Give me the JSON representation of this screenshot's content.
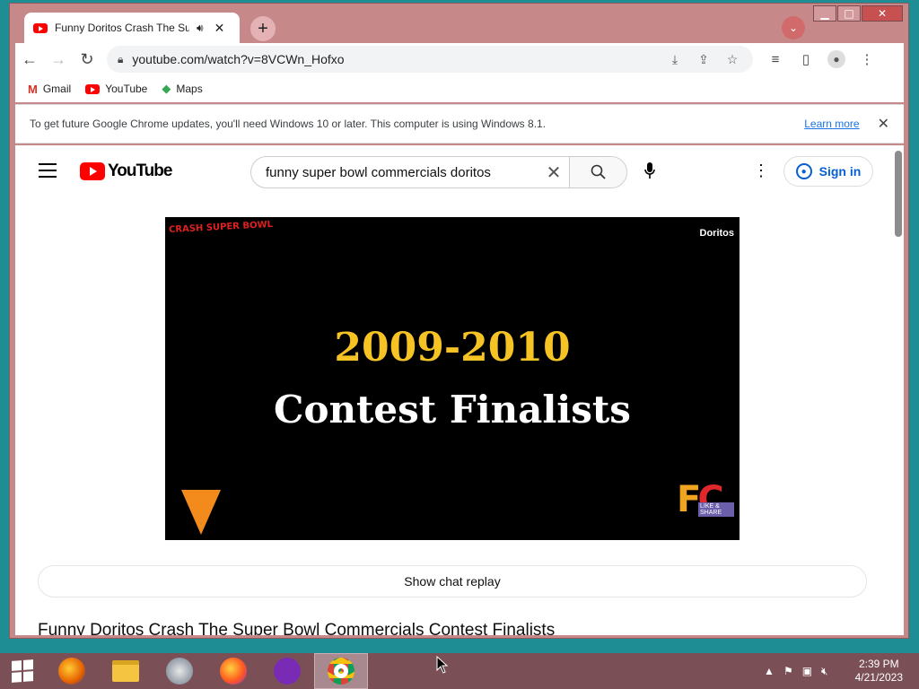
{
  "tab": {
    "title": "Funny Doritos Crash The Super Bowl Commercials Contest Finalists",
    "audio_icon": "speaker-icon",
    "close_icon": "close-icon"
  },
  "window_controls": {
    "minimize": "▁",
    "maximize": "□",
    "close": "✕"
  },
  "toolbar": {
    "url": "youtube.com/watch?v=8VCWn_Hofxo"
  },
  "bookmarks": [
    {
      "label": "Gmail",
      "icon": "gmail-icon"
    },
    {
      "label": "YouTube",
      "icon": "youtube-icon"
    },
    {
      "label": "Maps",
      "icon": "maps-icon"
    }
  ],
  "infobar": {
    "message": "To get future Google Chrome updates, you'll need Windows 10 or later. This computer is using Windows 8.1.",
    "link": "Learn more"
  },
  "youtube": {
    "logo_text": "YouTube",
    "search_value": "funny super bowl commercials doritos",
    "sign_in": "Sign in"
  },
  "video": {
    "badge_top_left": "CRASH SUPER BOWL",
    "badge_top_right": "Doritos",
    "line1": "2009-2010",
    "line2": "Contest Finalists",
    "logo_br_1": "F",
    "logo_br_2": "C",
    "logo_br_like": "LIKE & SHARE"
  },
  "chat_replay": "Show chat replay",
  "video_title": "Funny Doritos Crash The Super Bowl Commercials Contest Finalists",
  "taskbar": {
    "time": "2:39 PM",
    "date": "4/21/2023",
    "apps": [
      "firefox-icon",
      "file-explorer-icon",
      "thunderbird-icon",
      "firefox-icon",
      "privacy-browser-icon",
      "chrome-icon"
    ]
  },
  "colors": {
    "window_frame": "#c7888a",
    "taskbar": "#7b4f56",
    "desktop": "#1f8e94",
    "youtube_red": "#ff0000",
    "video_year": "#f6c324"
  }
}
